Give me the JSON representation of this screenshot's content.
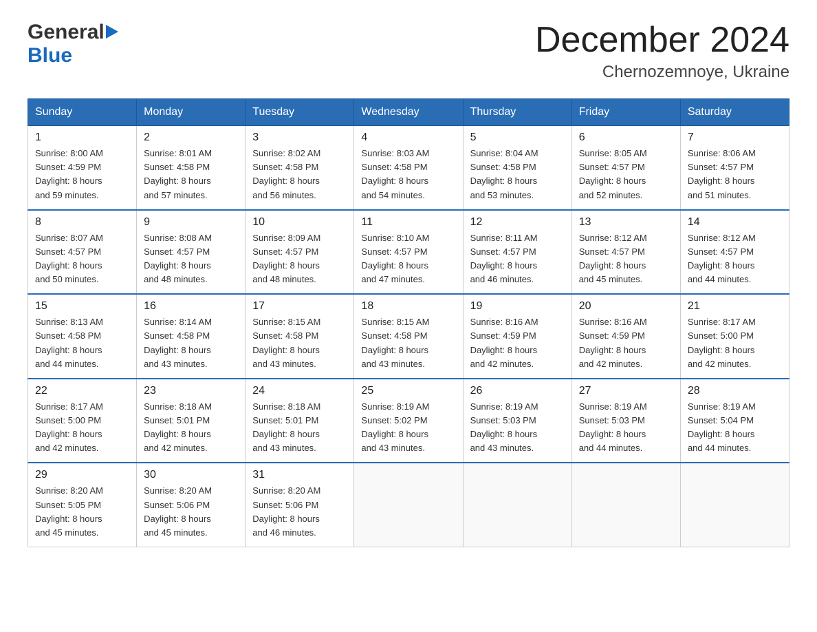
{
  "header": {
    "logo_general": "General",
    "logo_blue": "Blue",
    "month_year": "December 2024",
    "location": "Chernozemnoye, Ukraine"
  },
  "weekdays": [
    "Sunday",
    "Monday",
    "Tuesday",
    "Wednesday",
    "Thursday",
    "Friday",
    "Saturday"
  ],
  "weeks": [
    [
      {
        "day": "1",
        "sunrise": "Sunrise: 8:00 AM",
        "sunset": "Sunset: 4:59 PM",
        "daylight": "Daylight: 8 hours",
        "daylight2": "and 59 minutes."
      },
      {
        "day": "2",
        "sunrise": "Sunrise: 8:01 AM",
        "sunset": "Sunset: 4:58 PM",
        "daylight": "Daylight: 8 hours",
        "daylight2": "and 57 minutes."
      },
      {
        "day": "3",
        "sunrise": "Sunrise: 8:02 AM",
        "sunset": "Sunset: 4:58 PM",
        "daylight": "Daylight: 8 hours",
        "daylight2": "and 56 minutes."
      },
      {
        "day": "4",
        "sunrise": "Sunrise: 8:03 AM",
        "sunset": "Sunset: 4:58 PM",
        "daylight": "Daylight: 8 hours",
        "daylight2": "and 54 minutes."
      },
      {
        "day": "5",
        "sunrise": "Sunrise: 8:04 AM",
        "sunset": "Sunset: 4:58 PM",
        "daylight": "Daylight: 8 hours",
        "daylight2": "and 53 minutes."
      },
      {
        "day": "6",
        "sunrise": "Sunrise: 8:05 AM",
        "sunset": "Sunset: 4:57 PM",
        "daylight": "Daylight: 8 hours",
        "daylight2": "and 52 minutes."
      },
      {
        "day": "7",
        "sunrise": "Sunrise: 8:06 AM",
        "sunset": "Sunset: 4:57 PM",
        "daylight": "Daylight: 8 hours",
        "daylight2": "and 51 minutes."
      }
    ],
    [
      {
        "day": "8",
        "sunrise": "Sunrise: 8:07 AM",
        "sunset": "Sunset: 4:57 PM",
        "daylight": "Daylight: 8 hours",
        "daylight2": "and 50 minutes."
      },
      {
        "day": "9",
        "sunrise": "Sunrise: 8:08 AM",
        "sunset": "Sunset: 4:57 PM",
        "daylight": "Daylight: 8 hours",
        "daylight2": "and 48 minutes."
      },
      {
        "day": "10",
        "sunrise": "Sunrise: 8:09 AM",
        "sunset": "Sunset: 4:57 PM",
        "daylight": "Daylight: 8 hours",
        "daylight2": "and 48 minutes."
      },
      {
        "day": "11",
        "sunrise": "Sunrise: 8:10 AM",
        "sunset": "Sunset: 4:57 PM",
        "daylight": "Daylight: 8 hours",
        "daylight2": "and 47 minutes."
      },
      {
        "day": "12",
        "sunrise": "Sunrise: 8:11 AM",
        "sunset": "Sunset: 4:57 PM",
        "daylight": "Daylight: 8 hours",
        "daylight2": "and 46 minutes."
      },
      {
        "day": "13",
        "sunrise": "Sunrise: 8:12 AM",
        "sunset": "Sunset: 4:57 PM",
        "daylight": "Daylight: 8 hours",
        "daylight2": "and 45 minutes."
      },
      {
        "day": "14",
        "sunrise": "Sunrise: 8:12 AM",
        "sunset": "Sunset: 4:57 PM",
        "daylight": "Daylight: 8 hours",
        "daylight2": "and 44 minutes."
      }
    ],
    [
      {
        "day": "15",
        "sunrise": "Sunrise: 8:13 AM",
        "sunset": "Sunset: 4:58 PM",
        "daylight": "Daylight: 8 hours",
        "daylight2": "and 44 minutes."
      },
      {
        "day": "16",
        "sunrise": "Sunrise: 8:14 AM",
        "sunset": "Sunset: 4:58 PM",
        "daylight": "Daylight: 8 hours",
        "daylight2": "and 43 minutes."
      },
      {
        "day": "17",
        "sunrise": "Sunrise: 8:15 AM",
        "sunset": "Sunset: 4:58 PM",
        "daylight": "Daylight: 8 hours",
        "daylight2": "and 43 minutes."
      },
      {
        "day": "18",
        "sunrise": "Sunrise: 8:15 AM",
        "sunset": "Sunset: 4:58 PM",
        "daylight": "Daylight: 8 hours",
        "daylight2": "and 43 minutes."
      },
      {
        "day": "19",
        "sunrise": "Sunrise: 8:16 AM",
        "sunset": "Sunset: 4:59 PM",
        "daylight": "Daylight: 8 hours",
        "daylight2": "and 42 minutes."
      },
      {
        "day": "20",
        "sunrise": "Sunrise: 8:16 AM",
        "sunset": "Sunset: 4:59 PM",
        "daylight": "Daylight: 8 hours",
        "daylight2": "and 42 minutes."
      },
      {
        "day": "21",
        "sunrise": "Sunrise: 8:17 AM",
        "sunset": "Sunset: 5:00 PM",
        "daylight": "Daylight: 8 hours",
        "daylight2": "and 42 minutes."
      }
    ],
    [
      {
        "day": "22",
        "sunrise": "Sunrise: 8:17 AM",
        "sunset": "Sunset: 5:00 PM",
        "daylight": "Daylight: 8 hours",
        "daylight2": "and 42 minutes."
      },
      {
        "day": "23",
        "sunrise": "Sunrise: 8:18 AM",
        "sunset": "Sunset: 5:01 PM",
        "daylight": "Daylight: 8 hours",
        "daylight2": "and 42 minutes."
      },
      {
        "day": "24",
        "sunrise": "Sunrise: 8:18 AM",
        "sunset": "Sunset: 5:01 PM",
        "daylight": "Daylight: 8 hours",
        "daylight2": "and 43 minutes."
      },
      {
        "day": "25",
        "sunrise": "Sunrise: 8:19 AM",
        "sunset": "Sunset: 5:02 PM",
        "daylight": "Daylight: 8 hours",
        "daylight2": "and 43 minutes."
      },
      {
        "day": "26",
        "sunrise": "Sunrise: 8:19 AM",
        "sunset": "Sunset: 5:03 PM",
        "daylight": "Daylight: 8 hours",
        "daylight2": "and 43 minutes."
      },
      {
        "day": "27",
        "sunrise": "Sunrise: 8:19 AM",
        "sunset": "Sunset: 5:03 PM",
        "daylight": "Daylight: 8 hours",
        "daylight2": "and 44 minutes."
      },
      {
        "day": "28",
        "sunrise": "Sunrise: 8:19 AM",
        "sunset": "Sunset: 5:04 PM",
        "daylight": "Daylight: 8 hours",
        "daylight2": "and 44 minutes."
      }
    ],
    [
      {
        "day": "29",
        "sunrise": "Sunrise: 8:20 AM",
        "sunset": "Sunset: 5:05 PM",
        "daylight": "Daylight: 8 hours",
        "daylight2": "and 45 minutes."
      },
      {
        "day": "30",
        "sunrise": "Sunrise: 8:20 AM",
        "sunset": "Sunset: 5:06 PM",
        "daylight": "Daylight: 8 hours",
        "daylight2": "and 45 minutes."
      },
      {
        "day": "31",
        "sunrise": "Sunrise: 8:20 AM",
        "sunset": "Sunset: 5:06 PM",
        "daylight": "Daylight: 8 hours",
        "daylight2": "and 46 minutes."
      },
      null,
      null,
      null,
      null
    ]
  ]
}
